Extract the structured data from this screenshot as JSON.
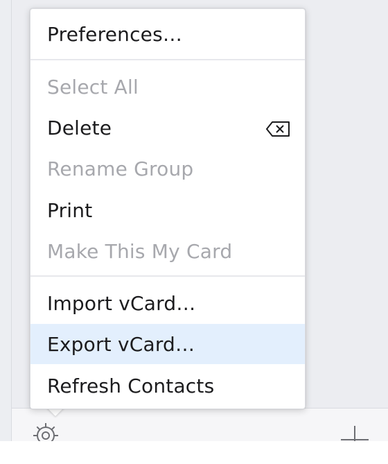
{
  "menu": {
    "items": [
      {
        "label": "Preferences…",
        "enabled": true
      },
      {
        "label": "Select All",
        "enabled": false
      },
      {
        "label": "Delete",
        "enabled": true,
        "shortcut_icon": "delete-key-icon"
      },
      {
        "label": "Rename Group",
        "enabled": false
      },
      {
        "label": "Print",
        "enabled": true
      },
      {
        "label": "Make This My Card",
        "enabled": false
      },
      {
        "label": "Import vCard…",
        "enabled": true
      },
      {
        "label": "Export vCard…",
        "enabled": true,
        "highlighted": true
      },
      {
        "label": "Refresh Contacts",
        "enabled": true
      }
    ]
  },
  "toolbar": {
    "icons": [
      "gear-icon",
      "add-icon"
    ]
  },
  "colors": {
    "menu_background": "#ffffff",
    "highlight": "#e3effd",
    "text_enabled": "#1c1c1e",
    "text_disabled": "#a7a8ad",
    "window_background": "#ecedf1"
  }
}
